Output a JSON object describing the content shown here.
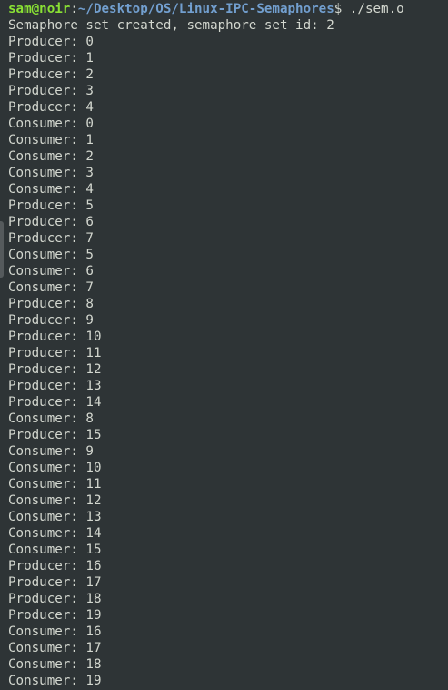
{
  "prompt": {
    "user_host": "sam@noir",
    "separator": ":",
    "path": "~/Desktop/OS/Linux-IPC-Semaphores",
    "dollar": "$ ",
    "command": "./sem.o"
  },
  "output_lines": [
    "Semaphore set created, semaphore set id: 2",
    "Producer: 0",
    "Producer: 1",
    "Producer: 2",
    "Producer: 3",
    "Producer: 4",
    "Consumer: 0",
    "Consumer: 1",
    "Consumer: 2",
    "Consumer: 3",
    "Consumer: 4",
    "Producer: 5",
    "Producer: 6",
    "Producer: 7",
    "Consumer: 5",
    "Consumer: 6",
    "Consumer: 7",
    "Producer: 8",
    "Producer: 9",
    "Producer: 10",
    "Producer: 11",
    "Producer: 12",
    "Producer: 13",
    "Producer: 14",
    "Consumer: 8",
    "Producer: 15",
    "Consumer: 9",
    "Consumer: 10",
    "Consumer: 11",
    "Consumer: 12",
    "Consumer: 13",
    "Consumer: 14",
    "Consumer: 15",
    "Producer: 16",
    "Producer: 17",
    "Producer: 18",
    "Producer: 19",
    "Consumer: 16",
    "Consumer: 17",
    "Consumer: 18",
    "Consumer: 19"
  ],
  "colors": {
    "background": "#2e3436",
    "foreground": "#d3d7cf",
    "user_host": "#8ae234",
    "path": "#729fcf"
  }
}
